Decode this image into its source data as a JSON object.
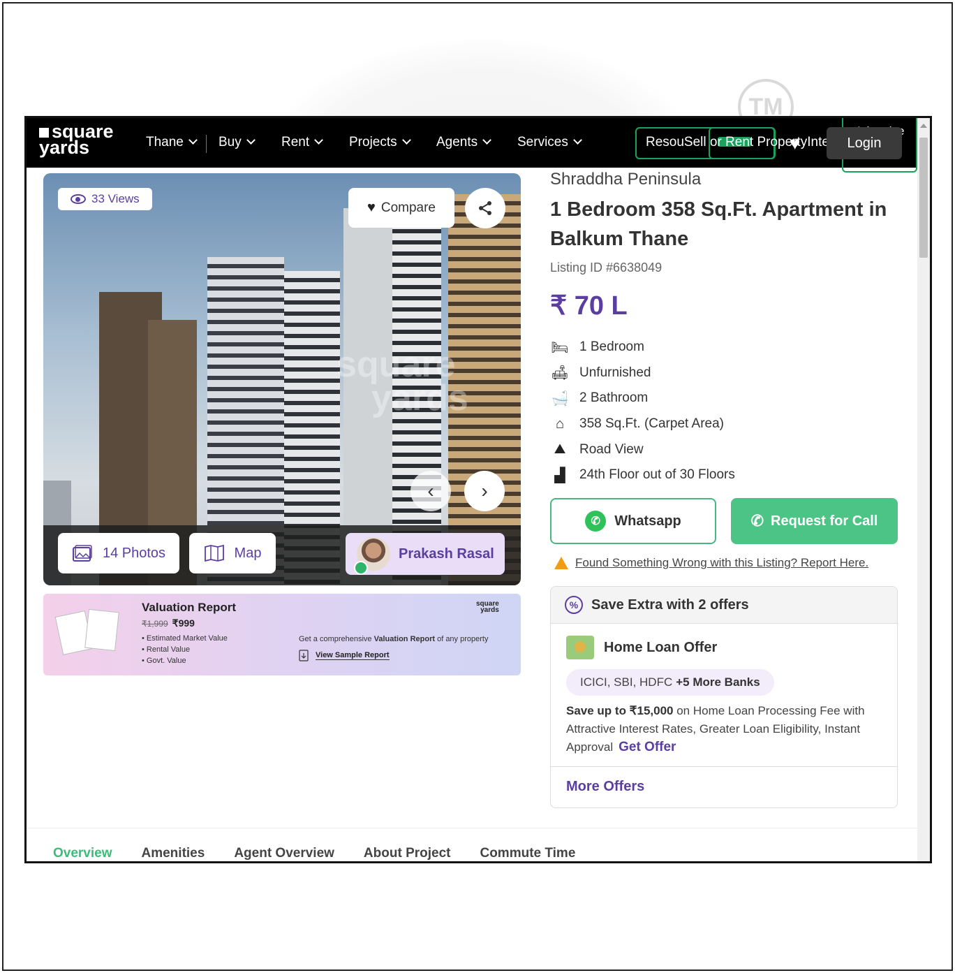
{
  "navbar": {
    "logo_line1": "square",
    "logo_line2": "yards",
    "city": "Thane",
    "items": [
      "Buy",
      "Rent",
      "Projects",
      "Agents",
      "Services"
    ],
    "overlap_text": "ResouSell or Rent PropertyIntelligence",
    "advertise": "Advertise with us",
    "login": "Login"
  },
  "gallery": {
    "views": "33 Views",
    "compare": "Compare",
    "watermark_line1": "square",
    "watermark_line2": "yards",
    "photos": "14 Photos",
    "map": "Map",
    "agent_name": "Prakash Rasal"
  },
  "valuation": {
    "title": "Valuation Report",
    "old_price": "₹1,999",
    "price": "₹999",
    "points": [
      "Estimated Market Value",
      "Rental Value",
      "Govt. Value"
    ],
    "desc_prefix": "Get a comprehensive ",
    "desc_bold": "Valuation Report",
    "desc_suffix": " of any property",
    "link": "View Sample Report",
    "logo_line1": "square",
    "logo_line2": "yards"
  },
  "listing": {
    "project": "Shraddha Peninsula",
    "title": "1 Bedroom 358 Sq.Ft. Apartment in Balkum Thane",
    "listing_id": "Listing ID #6638049",
    "price": "₹ 70 L",
    "features": [
      {
        "icon": "bed-icon",
        "text": "1 Bedroom"
      },
      {
        "icon": "sofa-icon",
        "text": "Unfurnished"
      },
      {
        "icon": "bathtub-icon",
        "text": "2 Bathroom"
      },
      {
        "icon": "home-icon",
        "text": "358 Sq.Ft. (Carpet Area)"
      },
      {
        "icon": "road-view-icon",
        "text": "Road View"
      },
      {
        "icon": "floor-icon",
        "text": "24th Floor out of 30 Floors"
      }
    ],
    "whatsapp": "Whatsapp",
    "request_call": "Request for Call",
    "report": "Found Something Wrong with this Listing? Report Here."
  },
  "offers": {
    "heading": "Save Extra with 2 offers",
    "loan_title": "Home Loan Offer",
    "banks": "ICICI, SBI, HDFC",
    "banks_more": "+5 More Banks",
    "desc_bold": "Save up to ₹15,000",
    "desc_rest": " on Home Loan Processing Fee with Attractive Interest Rates, Greater Loan Eligibility, Instant Approval",
    "get_offer": "Get Offer",
    "more_offers": "More Offers"
  },
  "tabs": [
    "Overview",
    "Amenities",
    "Agent Overview",
    "About Project",
    "Commute Time"
  ],
  "colors": {
    "brand_purple": "#5b3fa0",
    "accent_green": "#4cc485",
    "navbar_bg": "#000000"
  }
}
